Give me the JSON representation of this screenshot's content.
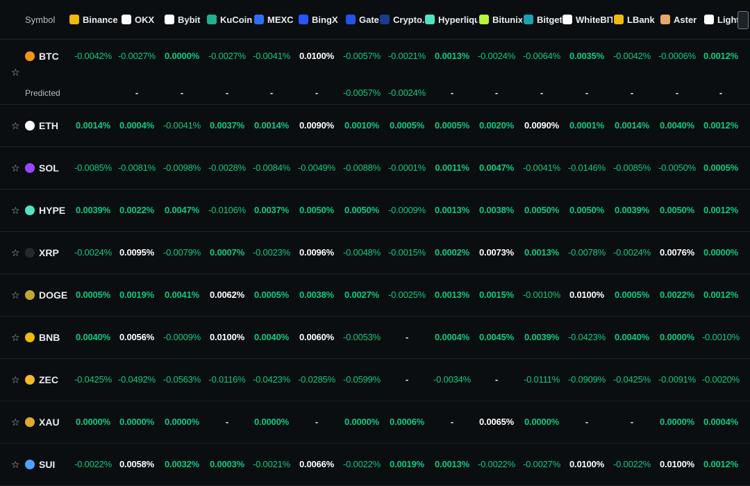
{
  "header": {
    "symbol_label": "Symbol",
    "exchanges": [
      {
        "name": "Binance",
        "icon": "binance-icon",
        "color": "#f0b90b"
      },
      {
        "name": "OKX",
        "icon": "okx-icon",
        "color": "#ffffff"
      },
      {
        "name": "Bybit",
        "icon": "bybit-icon",
        "color": "#ffffff"
      },
      {
        "name": "KuCoin",
        "icon": "kucoin-icon",
        "color": "#23af91"
      },
      {
        "name": "MEXC",
        "icon": "mexc-icon",
        "color": "#2b6ff5"
      },
      {
        "name": "BingX",
        "icon": "bingx-icon",
        "color": "#2a54ff"
      },
      {
        "name": "Gate",
        "icon": "gate-icon",
        "color": "#2354e6"
      },
      {
        "name": "Crypto.com",
        "icon": "crypto-com-icon",
        "color": "#1a3c8c"
      },
      {
        "name": "Hyperliquid",
        "icon": "hyperliquid-icon",
        "color": "#50e3c2"
      },
      {
        "name": "Bitunix",
        "icon": "bitunix-icon",
        "color": "#b8f53d"
      },
      {
        "name": "Bitget",
        "icon": "bitget-icon",
        "color": "#1da2b4"
      },
      {
        "name": "WhiteBIT",
        "icon": "whitebit-icon",
        "color": "#ffffff"
      },
      {
        "name": "LBank",
        "icon": "lbank-icon",
        "color": "#f0b90b"
      },
      {
        "name": "Aster",
        "icon": "aster-icon",
        "color": "#e8a86b"
      },
      {
        "name": "Lighter",
        "icon": "lighter-icon",
        "color": "#ffffff"
      }
    ]
  },
  "predicted_label": "Predicted",
  "rows": [
    {
      "symbol": "BTC",
      "icon": "btc-icon",
      "color": "#f7931a",
      "values": [
        "-0.0042%",
        "-0.0027%",
        "0.0000%",
        "-0.0027%",
        "-0.0041%",
        "0.0100%",
        "-0.0057%",
        "-0.0021%",
        "0.0013%",
        "-0.0024%",
        "-0.0064%",
        "0.0035%",
        "-0.0042%",
        "-0.0006%",
        "0.0012%"
      ],
      "predicted": [
        "-",
        "-",
        "-",
        "-",
        "-",
        "-0.0057%",
        "-0.0024%",
        "-",
        "-",
        "-",
        "-",
        "-",
        "-",
        "-"
      ]
    },
    {
      "symbol": "ETH",
      "icon": "eth-icon",
      "color": "#ffffff",
      "values": [
        "0.0014%",
        "0.0004%",
        "-0.0041%",
        "0.0037%",
        "0.0014%",
        "0.0090%",
        "0.0010%",
        "0.0005%",
        "0.0005%",
        "0.0020%",
        "0.0090%",
        "0.0001%",
        "0.0014%",
        "0.0040%",
        "0.0012%"
      ]
    },
    {
      "symbol": "SOL",
      "icon": "sol-icon",
      "color": "#9945ff",
      "values": [
        "-0.0085%",
        "-0.0081%",
        "-0.0098%",
        "-0.0028%",
        "-0.0084%",
        "-0.0049%",
        "-0.0088%",
        "-0.0001%",
        "0.0011%",
        "0.0047%",
        "-0.0041%",
        "-0.0146%",
        "-0.0085%",
        "-0.0050%",
        "0.0005%"
      ]
    },
    {
      "symbol": "HYPE",
      "icon": "hype-icon",
      "color": "#50e3c2",
      "values": [
        "0.0039%",
        "0.0022%",
        "0.0047%",
        "-0.0106%",
        "0.0037%",
        "0.0050%",
        "0.0050%",
        "-0.0009%",
        "0.0013%",
        "0.0038%",
        "0.0050%",
        "0.0050%",
        "0.0039%",
        "0.0050%",
        "0.0012%"
      ]
    },
    {
      "symbol": "XRP",
      "icon": "xrp-icon",
      "color": "#23292f",
      "values": [
        "-0.0024%",
        "0.0095%",
        "-0.0079%",
        "0.0007%",
        "-0.0023%",
        "0.0096%",
        "-0.0048%",
        "-0.0015%",
        "0.0002%",
        "0.0073%",
        "0.0013%",
        "-0.0078%",
        "-0.0024%",
        "0.0076%",
        "0.0000%"
      ]
    },
    {
      "symbol": "DOGE",
      "icon": "doge-icon",
      "color": "#c2a633",
      "values": [
        "0.0005%",
        "0.0019%",
        "0.0041%",
        "0.0062%",
        "0.0005%",
        "0.0038%",
        "0.0027%",
        "-0.0025%",
        "0.0013%",
        "0.0015%",
        "-0.0010%",
        "0.0100%",
        "0.0005%",
        "0.0022%",
        "0.0012%"
      ]
    },
    {
      "symbol": "BNB",
      "icon": "bnb-icon",
      "color": "#f0b90b",
      "values": [
        "0.0040%",
        "0.0056%",
        "-0.0009%",
        "0.0100%",
        "0.0040%",
        "0.0060%",
        "-0.0053%",
        "-",
        "0.0004%",
        "0.0045%",
        "0.0039%",
        "-0.0423%",
        "0.0040%",
        "0.0000%",
        "-0.0010%"
      ]
    },
    {
      "symbol": "ZEC",
      "icon": "zec-icon",
      "color": "#f4b728",
      "values": [
        "-0.0425%",
        "-0.0492%",
        "-0.0563%",
        "-0.0116%",
        "-0.0423%",
        "-0.0285%",
        "-0.0599%",
        "-",
        "-0.0034%",
        "-",
        "-0.0111%",
        "-0.0909%",
        "-0.0425%",
        "-0.0091%",
        "-0.0020%"
      ]
    },
    {
      "symbol": "XAU",
      "icon": "xau-icon",
      "color": "#e0a82e",
      "values": [
        "0.0000%",
        "0.0000%",
        "0.0000%",
        "-",
        "0.0000%",
        "-",
        "0.0000%",
        "0.0006%",
        "-",
        "0.0065%",
        "0.0000%",
        "-",
        "-",
        "0.0000%",
        "0.0004%"
      ]
    },
    {
      "symbol": "SUI",
      "icon": "sui-icon",
      "color": "#4da2ff",
      "values": [
        "-0.0022%",
        "0.0058%",
        "0.0032%",
        "0.0003%",
        "-0.0021%",
        "0.0066%",
        "-0.0022%",
        "0.0019%",
        "0.0013%",
        "-0.0022%",
        "-0.0027%",
        "0.0100%",
        "-0.0022%",
        "0.0100%",
        "0.0012%"
      ]
    }
  ]
}
